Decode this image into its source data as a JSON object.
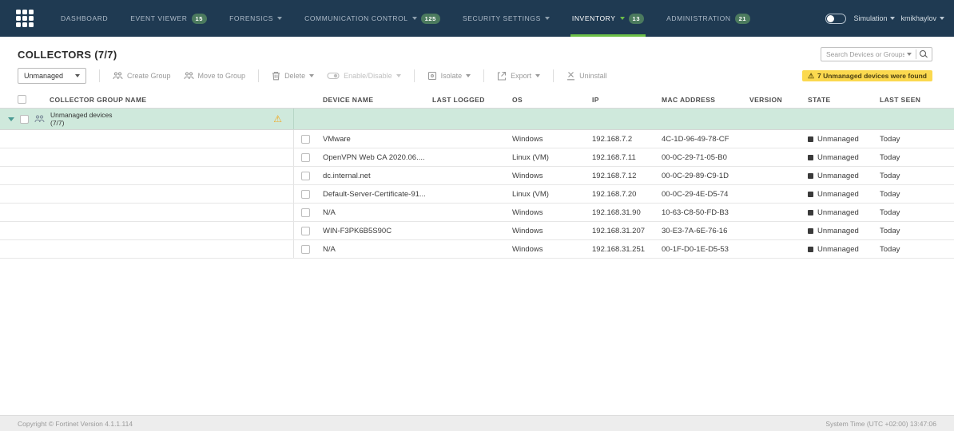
{
  "nav": {
    "items": [
      {
        "label": "DASHBOARD",
        "dropdown": false,
        "active": false
      },
      {
        "label": "EVENT VIEWER",
        "dropdown": false,
        "active": false,
        "badge": "15"
      },
      {
        "label": "FORENSICS",
        "dropdown": true,
        "active": false
      },
      {
        "label": "COMMUNICATION CONTROL",
        "dropdown": true,
        "active": false,
        "badge": "125"
      },
      {
        "label": "SECURITY SETTINGS",
        "dropdown": true,
        "active": false
      },
      {
        "label": "INVENTORY",
        "dropdown": true,
        "active": true,
        "badge": "13"
      },
      {
        "label": "ADMINISTRATION",
        "dropdown": false,
        "active": false,
        "badge": "21"
      }
    ],
    "simulation_label": "Simulation",
    "username": "kmikhaylov"
  },
  "page": {
    "title": "COLLECTORS (7/7)",
    "search_placeholder": "Search Devices or Groups",
    "warning_banner": "7 Unmanaged devices were found"
  },
  "toolbar": {
    "filter_value": "Unmanaged",
    "buttons": [
      "Create Group",
      "Move to Group",
      "Delete",
      "Enable/Disable",
      "Isolate",
      "Export",
      "Uninstall"
    ]
  },
  "table": {
    "columns": [
      "COLLECTOR GROUP NAME",
      "DEVICE NAME",
      "LAST LOGGED",
      "OS",
      "IP",
      "MAC ADDRESS",
      "VERSION",
      "STATE",
      "LAST SEEN"
    ],
    "group": {
      "name": "Unmanaged devices",
      "count": "(7/7)"
    },
    "rows": [
      {
        "device": "VMware",
        "last_logged": "",
        "os": "Windows",
        "ip": "192.168.7.2",
        "mac": "4C-1D-96-49-78-CF",
        "version": "",
        "state": "Unmanaged",
        "last_seen": "Today"
      },
      {
        "device": "OpenVPN Web CA 2020.06....",
        "last_logged": "",
        "os": "Linux (VM)",
        "ip": "192.168.7.11",
        "mac": "00-0C-29-71-05-B0",
        "version": "",
        "state": "Unmanaged",
        "last_seen": "Today"
      },
      {
        "device": "dc.internal.net",
        "last_logged": "",
        "os": "Windows",
        "ip": "192.168.7.12",
        "mac": "00-0C-29-89-C9-1D",
        "version": "",
        "state": "Unmanaged",
        "last_seen": "Today"
      },
      {
        "device": "Default-Server-Certificate-91...",
        "last_logged": "",
        "os": "Linux (VM)",
        "ip": "192.168.7.20",
        "mac": "00-0C-29-4E-D5-74",
        "version": "",
        "state": "Unmanaged",
        "last_seen": "Today"
      },
      {
        "device": "N/A",
        "last_logged": "",
        "os": "Windows",
        "ip": "192.168.31.90",
        "mac": "10-63-C8-50-FD-B3",
        "version": "",
        "state": "Unmanaged",
        "last_seen": "Today"
      },
      {
        "device": "WIN-F3PK6B5S90C",
        "last_logged": "",
        "os": "Windows",
        "ip": "192.168.31.207",
        "mac": "30-E3-7A-6E-76-16",
        "version": "",
        "state": "Unmanaged",
        "last_seen": "Today"
      },
      {
        "device": "N/A",
        "last_logged": "",
        "os": "Windows",
        "ip": "192.168.31.251",
        "mac": "00-1F-D0-1E-D5-53",
        "version": "",
        "state": "Unmanaged",
        "last_seen": "Today"
      }
    ]
  },
  "footer": {
    "left": "Copyright © Fortinet Version 4.1.1.114",
    "right": "System Time (UTC +02:00) 13:47:06"
  },
  "colors": {
    "nav_bg": "#1f3a52",
    "accent_green": "#6cbf47",
    "badge_green": "#4b7a5e",
    "group_row_bg": "#cfe9dc",
    "warning_badge_bg": "#fbd94f",
    "warning_icon": "#f2a71b"
  }
}
